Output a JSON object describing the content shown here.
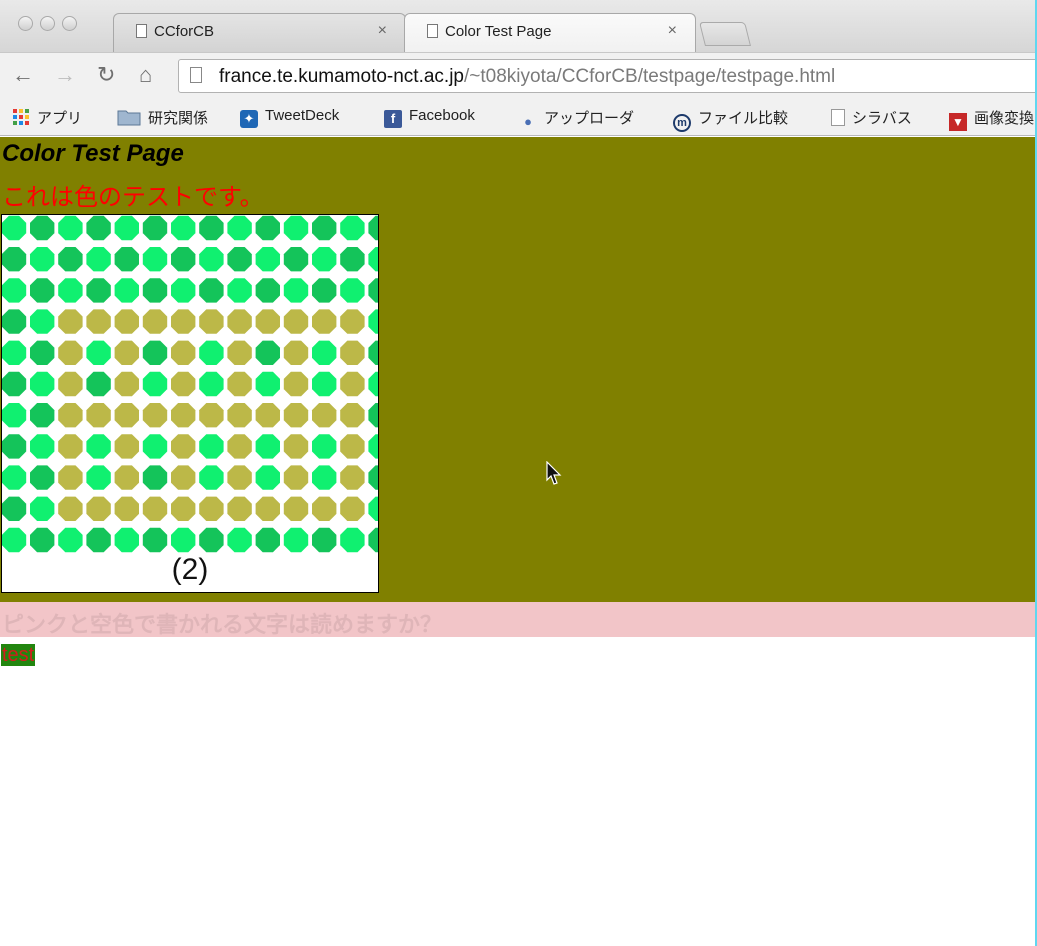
{
  "browser": {
    "tabs": [
      {
        "label": "CCforCB",
        "active": false
      },
      {
        "label": "Color Test Page",
        "active": true
      }
    ],
    "tab_close_glyph": "×",
    "url": {
      "host": "france.te.kumamoto-nct.ac.jp",
      "path": "/~t08kiyota/CCforCB/testpage/testpage.html"
    },
    "nav_icons": [
      "back-icon",
      "forward-icon",
      "reload-icon",
      "home-icon"
    ],
    "bookmarks": [
      {
        "label": "アプリ",
        "icon": "apps-grid-icon"
      },
      {
        "label": "研究関係",
        "icon": "folder-icon"
      },
      {
        "label": "TweetDeck",
        "icon": "tweetdeck-icon"
      },
      {
        "label": "Facebook",
        "icon": "facebook-icon"
      },
      {
        "label": "アップローダ",
        "icon": "uploader-icon"
      },
      {
        "label": "ファイル比較",
        "icon": "file-compare-icon"
      },
      {
        "label": "シラバス",
        "icon": "page-icon"
      },
      {
        "label": "画像変換",
        "icon": "image-convert-icon"
      }
    ]
  },
  "page": {
    "title": "Color Test Page",
    "red_text": "これは色のテストです。",
    "plate_label": "(2)",
    "pink_text": "ピンクと空色で書かれる文字は読めますか？",
    "test_text": "test"
  },
  "colors": {
    "olive_background": "#808000",
    "red_text": "#ff0000",
    "pink_bar": "#f2c5c8",
    "test_background": "#22860f",
    "test_text": "#d41d1d",
    "plate_dot_light": "#10f070",
    "plate_dot_dark": "#14c45a",
    "plate_dot_figure": "#bcb848"
  },
  "plate": {
    "description_pattern": [
      "01010101010101",
      "10101010101010",
      "01010101010101",
      "10222222222220",
      "01202120212021",
      "10212020202020",
      "01222222222221",
      "10202020202020",
      "01202120202021",
      "10222222222220",
      "01010101010101"
    ]
  }
}
